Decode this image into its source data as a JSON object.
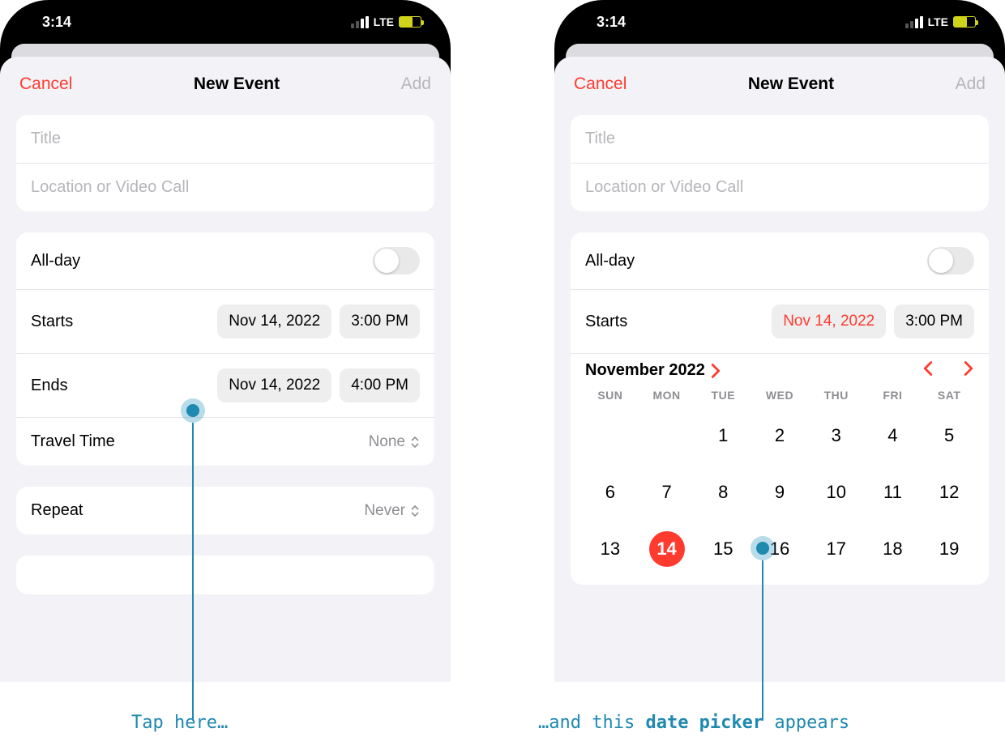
{
  "status": {
    "time": "3:14",
    "carrier_label": "LTE"
  },
  "nav": {
    "cancel": "Cancel",
    "title": "New Event",
    "add": "Add"
  },
  "inputs": {
    "title_placeholder": "Title",
    "location_placeholder": "Location or Video Call"
  },
  "datetime": {
    "allday_label": "All-day",
    "starts_label": "Starts",
    "ends_label": "Ends",
    "travel_label": "Travel Time",
    "travel_value": "None",
    "starts_date": "Nov 14, 2022",
    "starts_time": "3:00 PM",
    "ends_date": "Nov 14, 2022",
    "ends_time": "4:00 PM"
  },
  "repeat": {
    "label": "Repeat",
    "value": "Never"
  },
  "calendar": {
    "month_label": "November 2022",
    "weekdays": [
      "SUN",
      "MON",
      "TUE",
      "WED",
      "THU",
      "FRI",
      "SAT"
    ],
    "first_weekday_index": 2,
    "days_visible": [
      1,
      2,
      3,
      4,
      5,
      6,
      7,
      8,
      9,
      10,
      11,
      12,
      13,
      14,
      15,
      16,
      17,
      18,
      19
    ],
    "selected_day": 14
  },
  "annotations": {
    "left": "Tap here…",
    "right_prefix": "…and this ",
    "right_bold": "date picker",
    "right_suffix": " appears"
  }
}
